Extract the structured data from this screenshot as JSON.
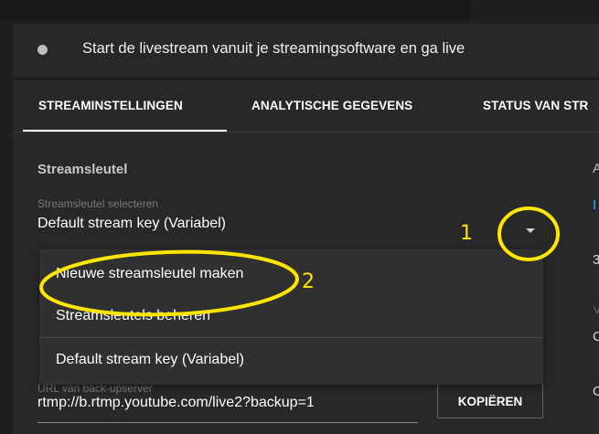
{
  "status": {
    "text": "Start de livestream vanuit je streamingsoftware en ga live"
  },
  "tabs": [
    {
      "label": "STREAMINSTELLINGEN",
      "active": true
    },
    {
      "label": "ANALYTISCHE GEGEVENS",
      "active": false
    },
    {
      "label": "STATUS VAN STR",
      "active": false
    }
  ],
  "stream_key": {
    "section_title": "Streamsleutel",
    "select_label": "Streamsleutel selecteren",
    "selected_value": "Default stream key (Variabel)"
  },
  "dropdown": {
    "items": [
      {
        "label": "Nieuwe streamsleutel maken"
      },
      {
        "label": "Streamsleutels beheren"
      },
      {
        "label": "Default stream key (Variabel)"
      }
    ]
  },
  "backup_server": {
    "label": "URL van back-upserver",
    "value": "rtmp://b.rtmp.youtube.com/live2?backup=1",
    "copy_label": "KOPIËREN"
  },
  "right_column": [
    "A",
    "I",
    "3",
    "V",
    "C",
    "C"
  ],
  "annotations": {
    "one": "1",
    "two": "2",
    "color": "#ffe600"
  },
  "colors": {
    "background": "#1f1f1f",
    "panel": "#282828",
    "menu": "#303030",
    "accent": "#ffe600"
  }
}
